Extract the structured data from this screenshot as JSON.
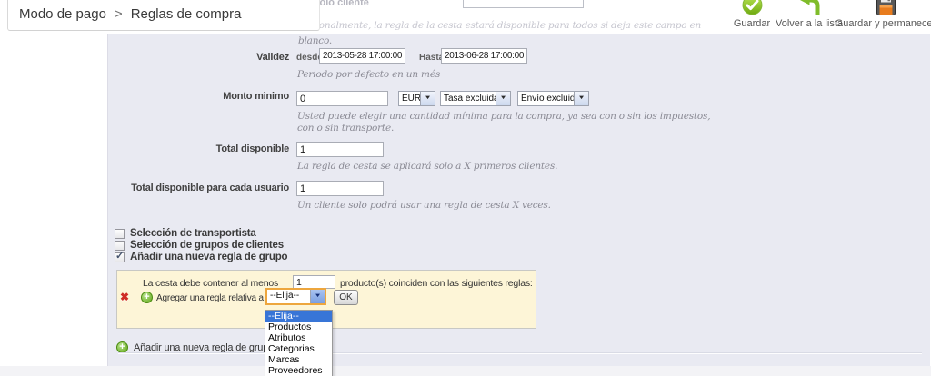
{
  "breadcrumb": {
    "section": "Modo de pago",
    "separator": ">",
    "page": "Reglas de compra"
  },
  "toolbar": {
    "save_label": "Guardar",
    "back_label": "Volver a la lista",
    "save_stay_label": "Guardar y permanecer"
  },
  "overlay": {
    "cut_field_label": "Limitar a un sólo cliente",
    "help_line1": "Opcionalmente, la regla de la cesta estará disponible para todos si deja este campo en",
    "help_line2": "blanco."
  },
  "form": {
    "validity": {
      "label": "Validez",
      "from_label": "desde",
      "from_value": "2013-05-28 17:00:00",
      "to_label": "Hasta",
      "to_value": "2013-06-28 17:00:00",
      "help": "Periodo por defecto en un més"
    },
    "min_amount": {
      "label": "Monto minimo",
      "value": "0",
      "currency": "EUR",
      "tax_option": "Tasa excluida",
      "shipping_option": "Envío excluido",
      "help_line1": "Usted puede elegir una cantidad mínima para la compra, ya sea con o sin los impuestos,",
      "help_line2": "con o sin transporte."
    },
    "total_available": {
      "label": "Total disponible",
      "value": "1",
      "help": "La regla de cesta se aplicará solo a X primeros clientes."
    },
    "total_per_user": {
      "label": "Total disponible para cada usuario",
      "value": "1",
      "help": "Un cliente solo podrá usar una regla de cesta X veces."
    },
    "checkboxes": [
      {
        "label": "Selección de transportista",
        "checked": false
      },
      {
        "label": "Selección de grupos de clientes",
        "checked": false
      },
      {
        "label": "Añadir una nueva regla de grupo",
        "checked": true
      }
    ],
    "group_rule_box": {
      "line1_prefix": "La cesta debe contener al menos",
      "quantity": "1",
      "line1_suffix": "producto(s) coinciden con las siguientes reglas:",
      "add_rule_label": "Agregar una regla relativa a",
      "rule_type_value": "--Elija--",
      "ok_label": "OK",
      "dropdown_options": [
        "--Elija--",
        "Productos",
        "Atributos",
        "Categorias",
        "Marcas",
        "Proveedores"
      ]
    },
    "add_group_rule_label": "Añadir una nueva regla de grupo"
  },
  "icons": {
    "delete": "✖",
    "add": "+",
    "check": "✓",
    "dropdown": "▼"
  },
  "colors": {
    "panel_bg": "#e9eaf2",
    "highlight_box_bg": "#fdf5d7",
    "accent_green": "#7fbc2a",
    "selection_blue": "#3875d7",
    "focus_orange": "#eda63e",
    "delete_red": "#cf2d26"
  }
}
